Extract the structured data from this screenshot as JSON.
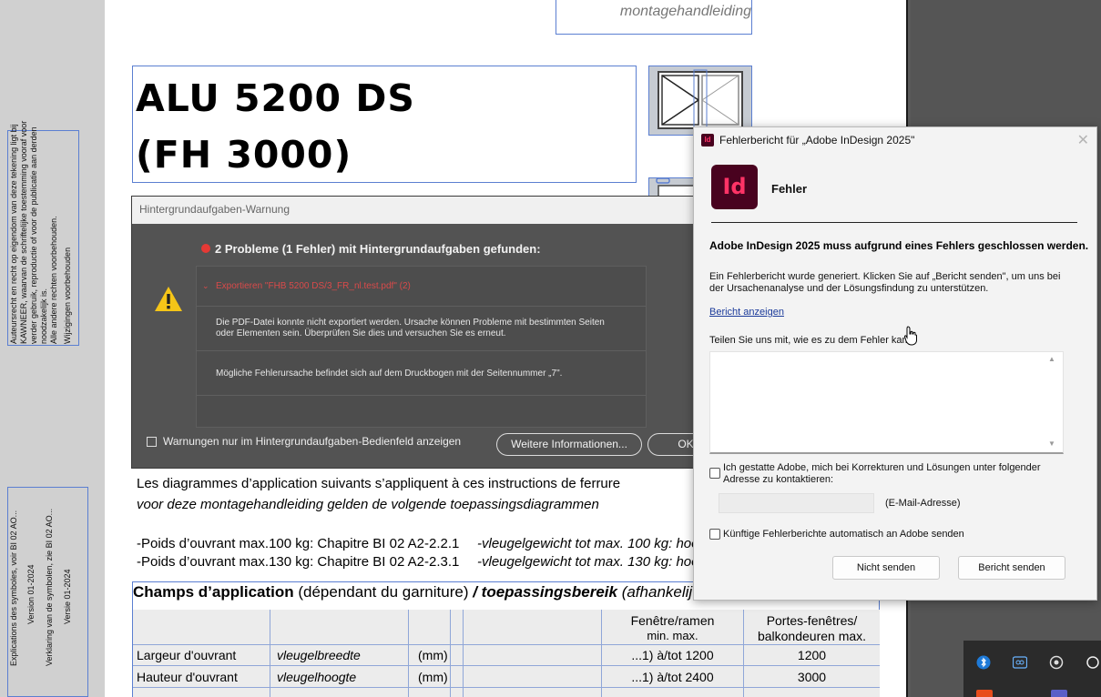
{
  "document": {
    "top_right_text": "montagehandleiding",
    "title_line1": "ALU 5200 DS",
    "title_line2": "(FH  3000)",
    "side_text_1": [
      "Auteursrecht en recht op eigendom van deze tekening ligt bij",
      "KAWNEER, waarvan de schriftelijke toestemming vooraf voor",
      "verder gebruik, reproductie of voor de publicatie aan derden",
      "noodzakelijk is.",
      "Alle andere rechten voorbehouden.",
      "Wijzigingen voorbehouden"
    ],
    "side_text_2": [
      "Explications des symboles, voir BI 02 AO...",
      "Version 01-2024",
      "Verklaring van de symbolen, zie BI 02 AO...",
      "Versie 01-2024"
    ],
    "body_line_fr": "Les diagrammes d’application suivants s’appliquent à ces instructions de ferrure",
    "body_line_nl": "voor deze montagehandleiding gelden de volgende toepassingsdiagrammen",
    "weight_fr_1": "-Poids d’ouvrant max.100 kg: Chapitre BI 02 A2-2.2.1",
    "weight_nl_1": "-vleugelgewicht tot max. 100 kg: hoo",
    "weight_fr_2": "-Poids d’ouvrant max.130 kg: Chapitre BI 02 A2-2.3.1",
    "weight_nl_2": "-vleugelgewicht tot max. 130 kg: hoo",
    "table": {
      "title_bold": "Champs d’application",
      "title_normal": " (dépendant du garniture) ",
      "title_bold_italic": "/ toepassingsbereik",
      "title_italic": " (afhankelij",
      "col_windows_line1": "Fenêtre/ramen",
      "col_windows_line2": "min.        max.",
      "col_doors_line1": "Portes-fenêtres/",
      "col_doors_line2": "balkondeuren max.",
      "rows": [
        {
          "fr": "Largeur d'ouvrant",
          "nl": "vleugelbreedte",
          "unit": "(mm)",
          "min": "...1) à/tot 1200",
          "doors": "1200"
        },
        {
          "fr": "Hauteur d'ouvrant",
          "nl": "vleugelhoogte",
          "unit": "(mm)",
          "min": "...1) à/tot 2400",
          "doors": "3000"
        }
      ]
    }
  },
  "warning_dialog": {
    "title": "Hintergrundaufgaben-Warnung",
    "heading": "2 Probleme (1 Fehler) mit Hintergrundaufgaben gefunden:",
    "item_title": "Exportieren \"FHB 5200 DS/3_FR_nl.test.pdf\" (2)",
    "desc_line1": "Die PDF-Datei konnte nicht exportiert werden. Ursache können Probleme mit bestimmten Seiten",
    "desc_line2": "oder Elementen sein. Überprüfen Sie dies und versuchen Sie es erneut.",
    "desc2": "Mögliche Fehlerursache befindet sich auf dem Druckbogen mit der Seitennummer „7\".",
    "checkbox_label": "Warnungen nur im Hintergrundaufgaben-Bedienfeld anzeigen",
    "more_info_button": "Weitere Informationen...",
    "ok_button": "OK"
  },
  "crash_dialog": {
    "title_icon": "Id",
    "title": "Fehlerbericht für „Adobe InDesign 2025\"",
    "logo_text": "Id",
    "heading": "Fehler",
    "main_message": "Adobe InDesign 2025 muss aufgrund eines Fehlers geschlossen werden.",
    "desc_line1": "Ein Fehlerbericht wurde generiert. Klicken Sie auf „Bericht senden\", um uns bei",
    "desc_line2": "der Ursachenanalyse und der Lösungsfindung zu unterstützen.",
    "view_report_link": "Bericht anzeigen",
    "ask_label": "Teilen Sie uns mit, wie es zu dem Fehler kam:",
    "comment_value": "",
    "contact_checkbox_line1": "Ich gestatte Adobe, mich bei Korrekturen und Lösungen unter folgender",
    "contact_checkbox_line2": "Adresse zu kontaktieren:",
    "email_value": "",
    "email_label": "(E-Mail-Adresse)",
    "auto_send_label": "Künftige Fehlerberichte automatisch an Adobe senden",
    "dont_send_button": "Nicht senden",
    "send_button": "Bericht senden"
  },
  "colors": {
    "indesign_dark": "#49021f",
    "indesign_pink": "#ff3366",
    "warning_yellow": "#f5c518",
    "error_red": "#d94a4a",
    "guide_blue": "#5b7fd1"
  }
}
